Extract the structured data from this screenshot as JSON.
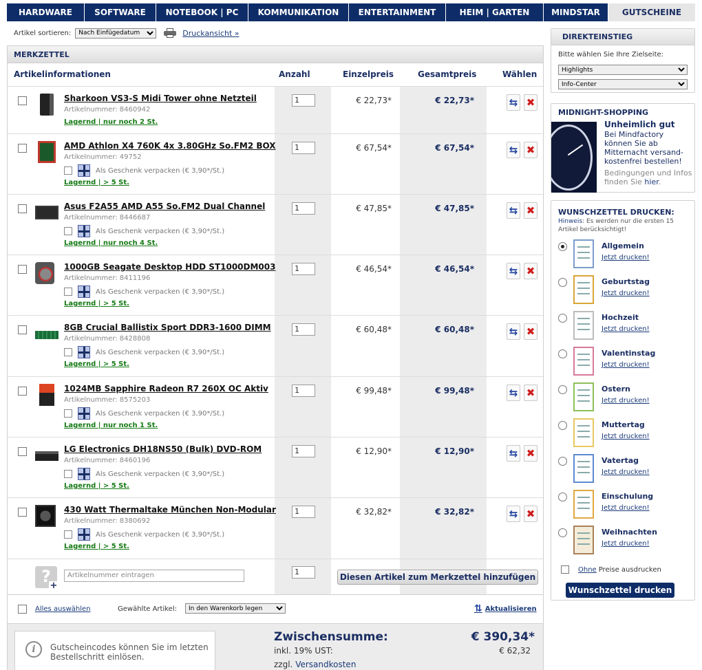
{
  "nav": {
    "items": [
      {
        "label": "HARDWARE",
        "active": false
      },
      {
        "label": "SOFTWARE",
        "active": false
      },
      {
        "label": "NOTEBOOK | PC",
        "active": false
      },
      {
        "label": "KOMMUNIKATION",
        "active": false
      },
      {
        "label": "ENTERTAINMENT",
        "active": false
      },
      {
        "label": "HEIM | GARTEN",
        "active": false
      },
      {
        "label": "MINDSTAR",
        "active": false
      },
      {
        "label": "GUTSCHEINE",
        "active": true
      }
    ]
  },
  "sort": {
    "label": "Artikel sortieren:",
    "selected": "Nach Einfügedatum",
    "print_link": "Druckansicht »"
  },
  "list": {
    "title": "MERKZETTEL",
    "headers": {
      "info": "Artikelinformationen",
      "qty": "Anzahl",
      "unit_price": "Einzelpreis",
      "total_price": "Gesamtpreis",
      "choose": "Wählen"
    },
    "gift_label": "Als Geschenk verpacken (€ 3,90*/St.)",
    "items": [
      {
        "name": "Sharkoon VS3-S Midi Tower ohne Netzteil",
        "artnr": "Artikelnummer: 8460942",
        "stock": "Lagernd | nur noch 2 St.",
        "qty": "1",
        "unit": "€ 22,73*",
        "total": "€ 22,73*",
        "gift": false
      },
      {
        "name": "AMD Athlon X4 760K 4x 3.80GHz So.FM2 BOX",
        "artnr": "Artikelnummer: 49752",
        "stock": "Lagernd | > 5 St.",
        "qty": "1",
        "unit": "€ 67,54*",
        "total": "€ 67,54*",
        "gift": true
      },
      {
        "name": "Asus F2A55 AMD A55 So.FM2 Dual Channel",
        "artnr": "Artikelnummer: 8446687",
        "stock": "Lagernd | nur noch 4 St.",
        "qty": "1",
        "unit": "€ 47,85*",
        "total": "€ 47,85*",
        "gift": true
      },
      {
        "name": "1000GB Seagate Desktop HDD ST1000DM003",
        "artnr": "Artikelnummer: 8411196",
        "stock": "Lagernd | > 5 St.",
        "qty": "1",
        "unit": "€ 46,54*",
        "total": "€ 46,54*",
        "gift": true
      },
      {
        "name": "8GB Crucial Ballistix Sport DDR3-1600 DIMM",
        "artnr": "Artikelnummer: 8428808",
        "stock": "Lagernd | > 5 St.",
        "qty": "1",
        "unit": "€ 60,48*",
        "total": "€ 60,48*",
        "gift": true
      },
      {
        "name": "1024MB Sapphire Radeon R7 260X OC Aktiv",
        "artnr": "Artikelnummer: 8575203",
        "stock": "Lagernd | nur noch 1 St.",
        "qty": "1",
        "unit": "€ 99,48*",
        "total": "€ 99,48*",
        "gift": true
      },
      {
        "name": "LG Electronics DH18NS50 (Bulk) DVD-ROM",
        "artnr": "Artikelnummer: 8460196",
        "stock": "Lagernd | > 5 St.",
        "qty": "1",
        "unit": "€ 12,90*",
        "total": "€ 12,90*",
        "gift": true
      },
      {
        "name": "430 Watt Thermaltake München Non-Modular",
        "artnr": "Artikelnummer: 8380692",
        "stock": "Lagernd | > 5 St.",
        "qty": "1",
        "unit": "€ 32,82*",
        "total": "€ 32,82*",
        "gift": true
      }
    ],
    "add": {
      "placeholder": "Artikelnummer eintragen",
      "qty": "1",
      "button": "Diesen Artikel zum Merkzettel hinzufügen"
    },
    "bottom": {
      "select_all": "Alles auswählen",
      "selected_label": "Gewählte Artikel:",
      "action": "In den Warenkorb legen",
      "update": "Aktualisieren"
    },
    "summary": {
      "voucher_link": "Gutscheincodes",
      "voucher_text": " können Sie im letzten Bestellschritt einlösen.",
      "subtotal_label": "Zwischensumme:",
      "subtotal": "€ 390,34*",
      "vat_label": "inkl. 19% UST:",
      "vat": "€ 62,32",
      "shipping_prefix": "zzgl. ",
      "shipping_link": "Versandkosten"
    }
  },
  "sidebar": {
    "direct": {
      "title": "DIREKTEINSTIEG",
      "label": "Bitte wählen Sie Ihre Zielseite:",
      "select1": "Highlights",
      "select2": "Info-Center"
    },
    "midnight": {
      "title": "MIDNIGHT-SHOPPING",
      "headline": "Unheimlich gut",
      "text": "Bei Mindfactory können Sie ab Mitternacht versand-kostenfrei bestellen!",
      "sub_text": "Bedingungen und Infos finden Sie ",
      "sub_link": "hier",
      "sub_end": "."
    },
    "wishlist": {
      "title": "WUNSCHZETTEL DRUCKEN:",
      "hint_link": "Hinweis",
      "hint_text": ": Es werden nur die ersten 15 Artikel berücksichtigt!",
      "print_link": "Jetzt drucken!",
      "options": [
        {
          "name": "Allgemein",
          "selected": true
        },
        {
          "name": "Geburtstag",
          "selected": false
        },
        {
          "name": "Hochzeit",
          "selected": false
        },
        {
          "name": "Valentinstag",
          "selected": false
        },
        {
          "name": "Ostern",
          "selected": false
        },
        {
          "name": "Muttertag",
          "selected": false
        },
        {
          "name": "Vatertag",
          "selected": false
        },
        {
          "name": "Einschulung",
          "selected": false
        },
        {
          "name": "Weihnachten",
          "selected": false
        }
      ],
      "no_price_u": "Ohne",
      "no_price_rest": "Preise ausdrucken",
      "print_button": "Wunschzettel drucken"
    }
  },
  "colors": {
    "nav_bg": "#0e2d68",
    "heading": "#1a2e62",
    "stock_green": "#157a15",
    "delete_red": "#d01c1c"
  }
}
